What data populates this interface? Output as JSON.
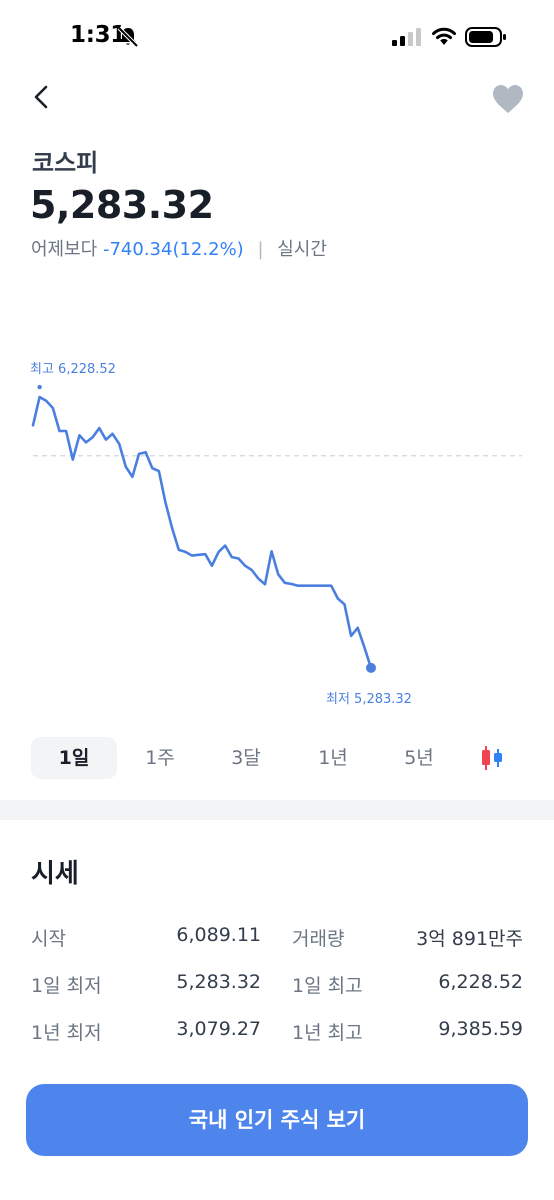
{
  "status_bar": {
    "time": "1:31"
  },
  "header": {
    "name": "코스피",
    "price": "5,283.32",
    "change_prefix": "어제보다",
    "change_value": "-740.34(12.2%)",
    "separator": "|",
    "realtime": "실시간"
  },
  "colors": {
    "accent": "#3182f6",
    "line": "#4a7fe0",
    "cta": "#4e85ec",
    "candle_up": "#f04452",
    "candle_down": "#3182f6"
  },
  "chart_data": {
    "type": "line",
    "high_label": "최고 6,228.52",
    "low_label": "최저 5,283.32",
    "reference_value": 6023.66,
    "ylim": [
      5220,
      6260
    ],
    "values": [
      6130,
      6228.52,
      6215,
      6190,
      6110,
      6110,
      6010,
      6095,
      6070,
      6088,
      6120,
      6080,
      6100,
      6065,
      5985,
      5950,
      6030,
      6036,
      5980,
      5970,
      5860,
      5770,
      5695,
      5688,
      5675,
      5678,
      5680,
      5640,
      5688,
      5710,
      5670,
      5665,
      5640,
      5625,
      5595,
      5575,
      5690,
      5610,
      5580,
      5576,
      5570,
      5570,
      5570,
      5570,
      5570,
      5570,
      5525,
      5505,
      5395,
      5423,
      5355,
      5283.32
    ]
  },
  "periods": [
    "1일",
    "1주",
    "3달",
    "1년",
    "5년"
  ],
  "active_period": 0,
  "section": {
    "title": "시세",
    "rows": [
      {
        "l1": "시작",
        "v1": "6,089.11",
        "l2": "거래량",
        "v2": "3억 891만주"
      },
      {
        "l1": "1일 최저",
        "v1": "5,283.32",
        "l2": "1일 최고",
        "v2": "6,228.52"
      },
      {
        "l1": "1년 최저",
        "v1": "3,079.27",
        "l2": "1년 최고",
        "v2": "9,385.59"
      }
    ]
  },
  "cta_label": "국내 인기 주식 보기",
  "icons": {
    "back": "chevron-left-icon",
    "favorite": "heart-icon",
    "silent": "bell-slash-icon",
    "candle": "candlestick-icon"
  }
}
